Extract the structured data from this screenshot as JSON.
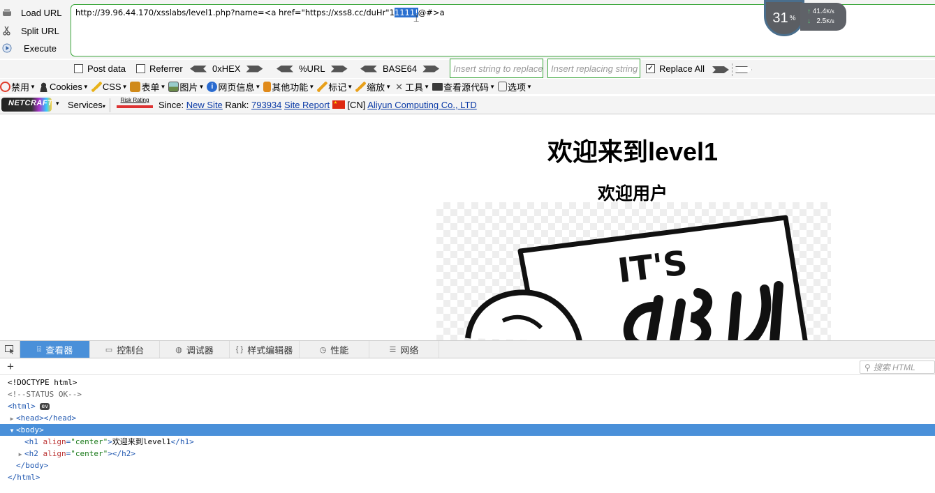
{
  "hackbar": {
    "actions": [
      "Load URL",
      "Split URL",
      "Execute"
    ],
    "url_before": "http://39.96.44.170/xsslabs/level1.php?name=<a href=\"https://xss8.cc/duHr\"1",
    "url_selected": "1111!",
    "url_after": "@#>a",
    "post_data_label": "Post data",
    "referrer_label": "Referrer",
    "hex_label": "0xHEX",
    "url_label": "%URL",
    "base64_label": "BASE64",
    "insert_placeholder": "Insert string to replace",
    "replacing_placeholder": "Insert replacing string",
    "replace_all_label": "Replace All",
    "replace_all_checked": true
  },
  "speed_widget": {
    "percent": "31",
    "percent_unit": "%",
    "upload": "41.4",
    "download": "2.5",
    "rate_unit": "K/s"
  },
  "toolbar": {
    "items": [
      {
        "label": "禁用",
        "icon": "disable-icon",
        "color": "#e03b2a"
      },
      {
        "label": "Cookies",
        "icon": "person-icon",
        "color": "#333333"
      },
      {
        "label": "CSS",
        "icon": "pencil-icon",
        "color": "#e8b21a"
      },
      {
        "label": "表单",
        "icon": "form-icon",
        "color": "#d08a1a"
      },
      {
        "label": "图片",
        "icon": "image-icon",
        "color": "#6a8a4a"
      },
      {
        "label": "网页信息",
        "icon": "info-icon",
        "color": "#2a6bd0"
      },
      {
        "label": "其他功能",
        "icon": "misc-icon",
        "color": "#e08a1a"
      },
      {
        "label": "标记",
        "icon": "highlight-icon",
        "color": "#e8a01a"
      },
      {
        "label": "缩放",
        "icon": "resize-icon",
        "color": "#e8a01a"
      },
      {
        "label": "工具",
        "icon": "tools-icon",
        "color": "#555555"
      },
      {
        "label": "查看源代码",
        "icon": "source-icon",
        "color": "#3a3a3a"
      },
      {
        "label": "选项",
        "icon": "options-icon",
        "color": "#555555"
      }
    ]
  },
  "netcraft": {
    "logo_text": "NETCRAFT",
    "services_label": "Services",
    "risk_label": "Risk Rating",
    "since_label": "Since:",
    "since_link": "New Site",
    "rank_label": "Rank:",
    "rank_value": "793934",
    "site_report": "Site Report",
    "country": "[CN]",
    "host": "Aliyun Computing Co., LTD"
  },
  "page": {
    "h1": "欢迎来到level1",
    "h2": "欢迎用户",
    "image_text_top": "IT'S"
  },
  "devtools": {
    "tabs": [
      {
        "label": "查看器",
        "icon": "inspector-icon",
        "active": true
      },
      {
        "label": "控制台",
        "icon": "console-icon",
        "active": false
      },
      {
        "label": "调试器",
        "icon": "debugger-icon",
        "active": false
      },
      {
        "label": "样式编辑器",
        "icon": "style-editor-icon",
        "active": false
      },
      {
        "label": "性能",
        "icon": "performance-icon",
        "active": false
      },
      {
        "label": "网络",
        "icon": "network-icon",
        "active": false
      }
    ],
    "search_placeholder": "搜索 HTML",
    "dom": {
      "doctype": "<!DOCTYPE html>",
      "comment": "<!--STATUS OK-->",
      "html_open": "<html>",
      "event_badge": "ev",
      "head_open": "<head>",
      "head_close": "</head>",
      "body_open": "<body>",
      "h1_open": "<h1",
      "h1_attr": "align",
      "h1_val": "\"center\"",
      "h1_text": "欢迎来到level1",
      "h1_close": "</h1>",
      "h2_open": "<h2",
      "h2_attr": "align",
      "h2_val": "\"center\"",
      "h2_close": "></h2>",
      "body_close": "</body>",
      "html_close": "</html>"
    }
  }
}
